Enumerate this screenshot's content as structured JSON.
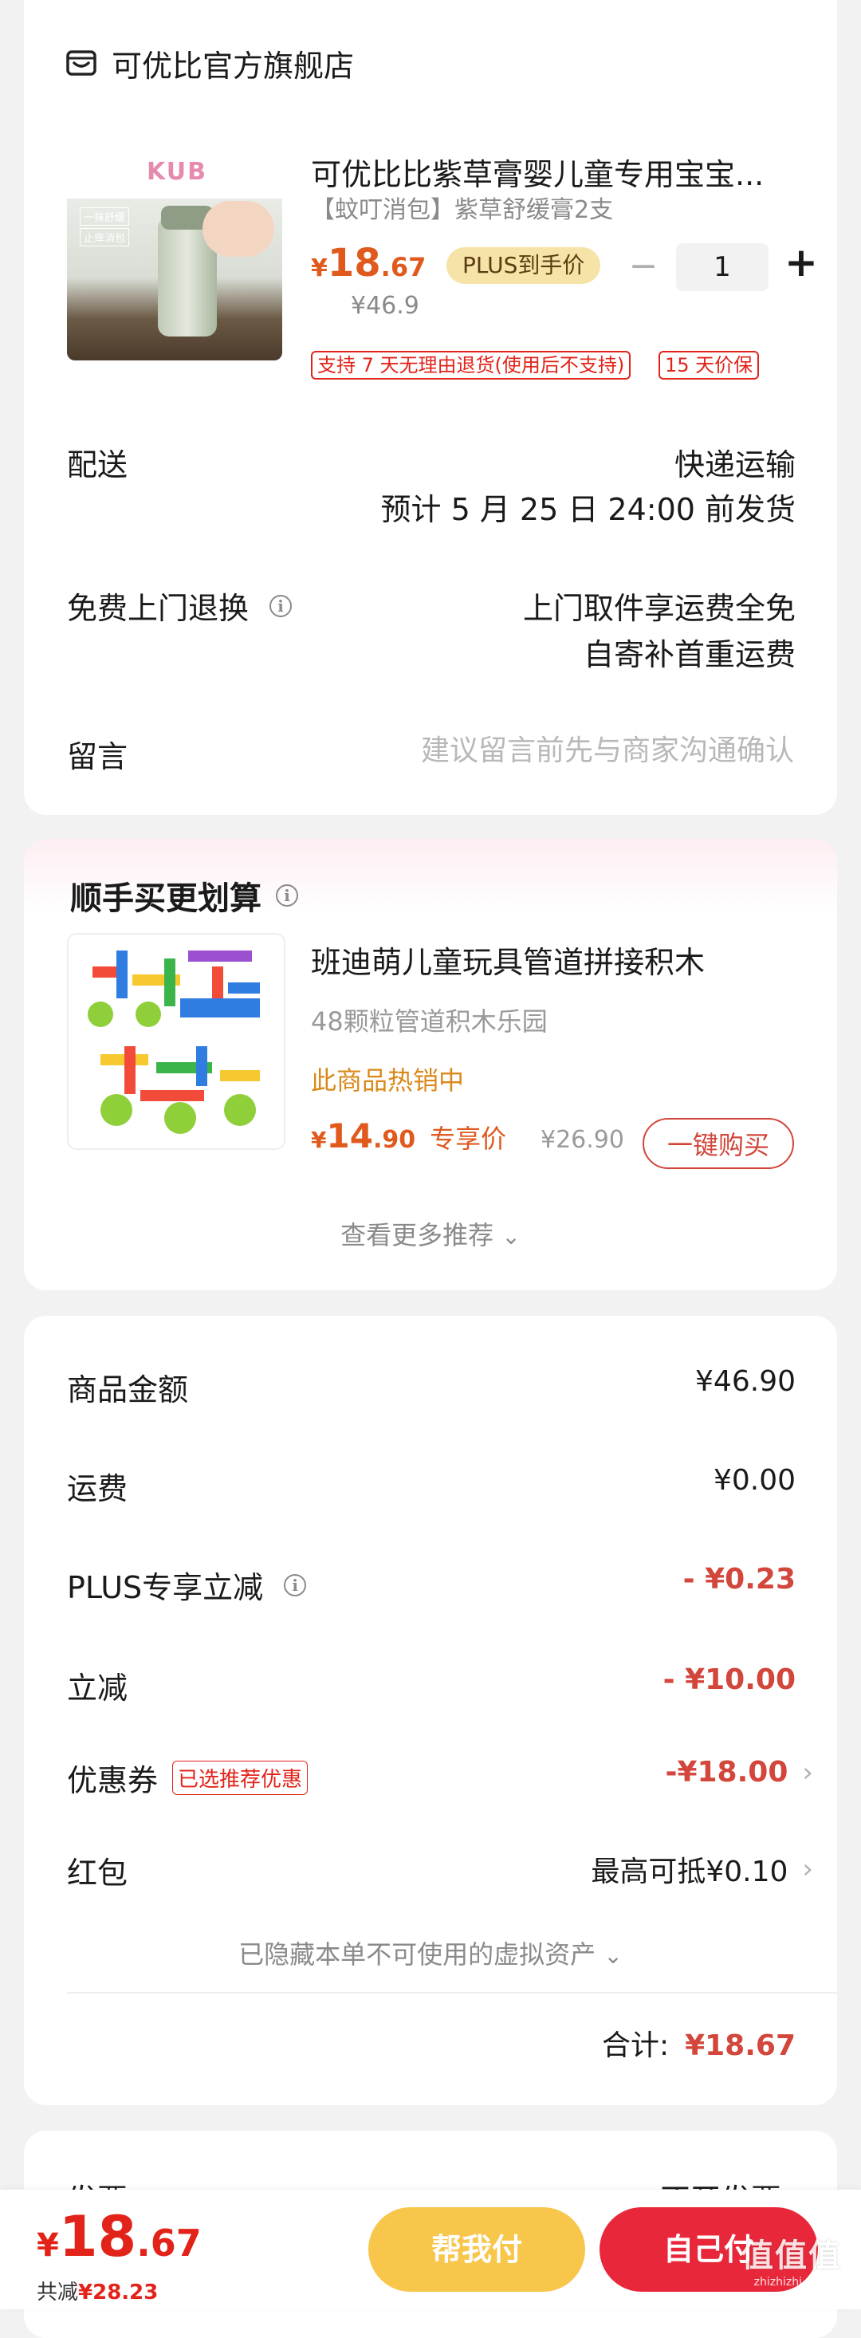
{
  "store": {
    "name": "可优比官方旗舰店"
  },
  "product": {
    "title": "可优比比紫草膏婴儿童专用宝宝...",
    "subtitle": "【蚊叮消包】紫草舒缓膏2支",
    "price_symbol": "¥",
    "price_int": "18",
    "price_dec": ".67",
    "plus_badge": "PLUS到手价",
    "original_price": "¥46.9",
    "quantity": "1",
    "minus": "−",
    "plus": "+",
    "tag_return": "支持 7 天无理由退货(使用后不支持)",
    "tag_price_protect": "15 天价保",
    "image_brand": "KUB",
    "image_label_1": "一抹舒缓",
    "image_label_2": "止痒消包"
  },
  "delivery": {
    "label": "配送",
    "method": "快递运输",
    "eta": "预计 5 月 25 日 24:00 前发货"
  },
  "free_return": {
    "label": "免费上门退换",
    "line1": "上门取件享运费全免",
    "line2": "自寄补首重运费"
  },
  "note": {
    "label": "留言",
    "placeholder": "建议留言前先与商家沟通确认"
  },
  "recommend": {
    "title": "顺手买更划算",
    "item_title": "班迪萌儿童玩具管道拼接积木",
    "item_sub": "48颗粒管道积木乐园",
    "item_hot": "此商品热销中",
    "price_symbol": "¥",
    "price_int": "14",
    "price_dec": ".90",
    "exclusive": "专享价",
    "original_price": "¥26.90",
    "buy_button": "一键购买",
    "more": "查看更多推荐"
  },
  "summary": {
    "goods_label": "商品金额",
    "goods_value": "¥46.90",
    "shipping_label": "运费",
    "shipping_value": "¥0.00",
    "plus_label": "PLUS专享立减",
    "plus_value": "- ¥0.23",
    "discount_label": "立减",
    "discount_value": "- ¥10.00",
    "coupon_label": "优惠券",
    "coupon_tag": "已选推荐优惠",
    "coupon_value": "-¥18.00",
    "redpacket_label": "红包",
    "redpacket_value": "最高可抵¥0.10",
    "hidden_assets": "已隐藏本单不可使用的虚拟资产",
    "total_label": "合计:",
    "total_value": "¥18.67"
  },
  "partial_row": {
    "left": "发票",
    "right": "不开发票"
  },
  "bottom_bar": {
    "price_symbol": "¥",
    "price_int": "18",
    "price_dec": ".67",
    "saved_label": "共减",
    "saved_value": "¥28.23",
    "help_pay": "帮我付",
    "self_pay": "自己付"
  },
  "watermark": {
    "text": "值值值",
    "sub": "zhizhizhi.com"
  },
  "colors": {
    "accent_red": "#e2231a",
    "orange_price": "#e05a1e",
    "plus_gold": "#f6e3a8",
    "button_yellow": "#f7c64b",
    "button_red": "#e8283a"
  }
}
